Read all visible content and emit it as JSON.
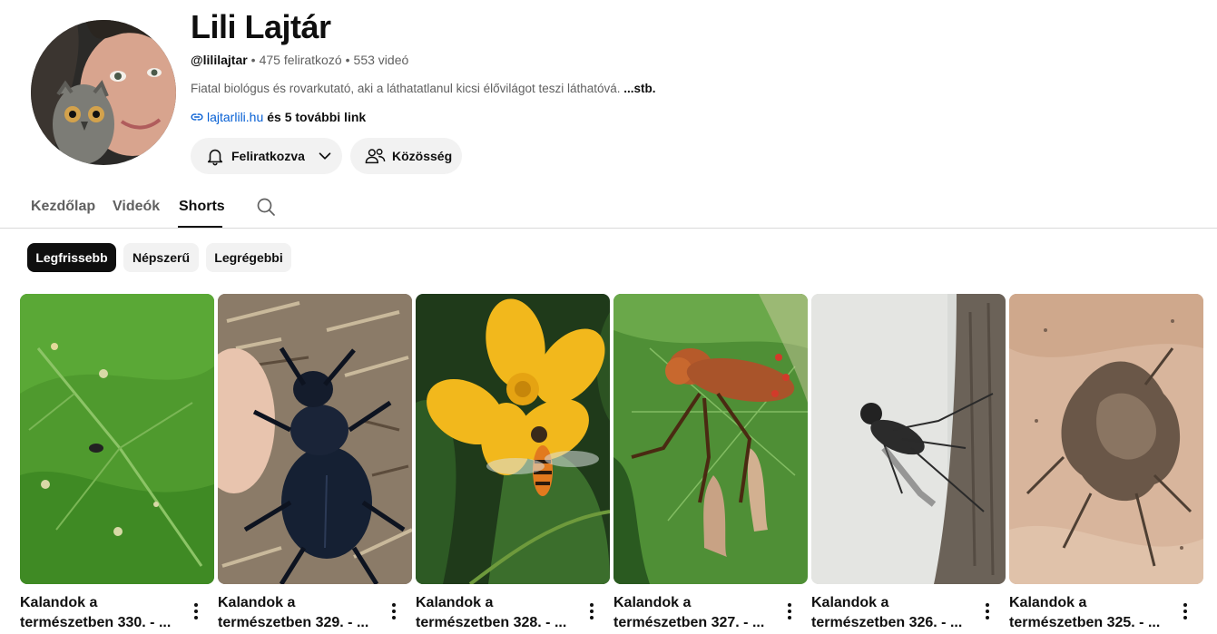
{
  "channel": {
    "name": "Lili Lajtár",
    "handle": "@lililajtar",
    "subscribers": "475 feliratkozó",
    "videos": "553 videó",
    "separator": "•",
    "description": "Fiatal biológus és rovarkutató, aki a láthatatlanul kicsi élővilágot teszi láthatóvá.",
    "description_more": "...stb.",
    "link_text": "lajtarlili.hu",
    "link_more": "és 5 további link"
  },
  "buttons": {
    "subscribed_label": "Feliratkozva",
    "community_label": "Közösség"
  },
  "tabs": [
    {
      "label": "Kezdőlap",
      "active": false
    },
    {
      "label": "Videók",
      "active": false
    },
    {
      "label": "Shorts",
      "active": true
    }
  ],
  "chips": [
    {
      "label": "Legfrissebb",
      "selected": true
    },
    {
      "label": "Népszerű",
      "selected": false
    },
    {
      "label": "Legrégebbi",
      "selected": false
    }
  ],
  "shorts": [
    {
      "title_line1": "Kalandok a",
      "title_line2": "természetben 330. - ..."
    },
    {
      "title_line1": "Kalandok a",
      "title_line2": "természetben 329. - ..."
    },
    {
      "title_line1": "Kalandok a",
      "title_line2": "természetben 328. - ..."
    },
    {
      "title_line1": "Kalandok a",
      "title_line2": "természetben 327. - ..."
    },
    {
      "title_line1": "Kalandok a",
      "title_line2": "természetben 326. - ..."
    },
    {
      "title_line1": "Kalandok a",
      "title_line2": "természetben 325. - ..."
    }
  ],
  "icons": {
    "subscribed_button": "bell-icon",
    "subscribed_dropdown": "chevron-down-icon",
    "community_button": "people-icon",
    "link": "link-icon",
    "search": "search-icon",
    "card_menu": "more-vert-icon"
  },
  "colors": {
    "link": "#065fd4",
    "chip_selected_bg": "#0f0f0f",
    "chip_bg": "#f2f2f2",
    "text_secondary": "#606060"
  }
}
